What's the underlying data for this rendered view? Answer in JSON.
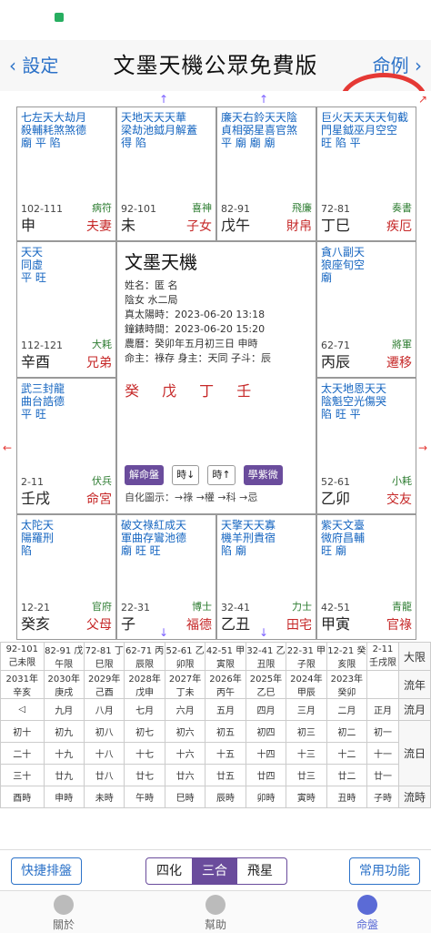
{
  "nav": {
    "back_label": "設定",
    "title": "文墨天機公眾免費版",
    "next_label": "命例"
  },
  "cells": [
    {
      "name": "top-left",
      "stars": "七左天大劫月\n殺輔耗煞煞德\n廟 平 陷",
      "branch": "申",
      "palace": "夫妻",
      "range": "102-111",
      "minor": "病符"
    },
    {
      "name": "top-mid-left",
      "stars": "天地天天天華\n梁劫池鉞月解蓋\n得 陷",
      "branch": "未",
      "palace": "子女",
      "range": "92-101",
      "minor": "喜神"
    },
    {
      "name": "top-mid-right",
      "stars": "廉天右鈴天天陰\n貞相弼星喜官煞\n平 廟 廟 廟",
      "branch": "戊午",
      "palace": "財帛",
      "range": "82-91",
      "minor": "飛廉"
    },
    {
      "name": "top-right",
      "stars": "巨火天天天天旬截\n門星鉞巫月空空\n旺 陷 平",
      "branch": "丁巳",
      "palace": "疾厄",
      "range": "72-81",
      "minor": "奏書"
    },
    {
      "name": "mid-left-top",
      "stars": "天天\n同虛\n平 旺",
      "branch": "辛酉",
      "palace": "兄弟",
      "range": "112-121",
      "minor": "大耗"
    },
    {
      "name": "mid-right-top",
      "stars": "貪八副天\n狼座旬空\n廟",
      "branch": "丙辰",
      "palace": "遷移",
      "range": "62-71",
      "minor": "將軍"
    },
    {
      "name": "mid-left-bot",
      "stars": "武三封龍\n曲台誥德\n平 旺",
      "branch": "壬戌",
      "palace": "命宮",
      "range": "2-11",
      "minor": "伏兵"
    },
    {
      "name": "mid-right-bot",
      "stars": "太天地恩天天\n陰魁空光傷哭\n陷 旺 平",
      "branch": "乙卯",
      "palace": "交友",
      "range": "52-61",
      "minor": "小耗"
    },
    {
      "name": "bot-left",
      "stars": "太陀天\n陽羅刑\n陷",
      "branch": "癸亥",
      "palace": "父母",
      "range": "12-21",
      "minor": "官府"
    },
    {
      "name": "bot-mid-left",
      "stars": "破文祿紅成天\n軍曲存鸞池德\n廟 旺 旺",
      "branch": "子",
      "palace": "福德",
      "range": "22-31",
      "minor": "博士"
    },
    {
      "name": "bot-mid-right",
      "stars": "天擎天天寡\n機羊刑貴宿\n陷 廟",
      "branch": "乙丑",
      "palace": "田宅",
      "range": "32-41",
      "minor": "力士"
    },
    {
      "name": "bot-right",
      "stars": "紫天文臺\n微府昌輔\n旺 廟",
      "branch": "甲寅",
      "palace": "官祿",
      "range": "42-51",
      "minor": "青龍"
    }
  ],
  "center": {
    "title": "文墨天機",
    "info": [
      "姓名：匿 名",
      "陰女 水二局",
      "真太陽時：2023-06-20 13:18",
      "鐘錶時間：2023-06-20 15:20",
      "農曆：癸卯年五月初三日 申時",
      "命主：祿存 身主：天同 子斗：辰"
    ],
    "gan": "癸 戊 丁 壬",
    "btn_jieming": "解命盤",
    "btn_shi_prev": "時↓",
    "btn_shi_next": "時↑",
    "btn_xue": "學紫微",
    "legend": "自化圖示：→祿 →權 →科 →忌"
  },
  "grid": {
    "row_dayun": [
      "92-101 己未限",
      "82-91 戊午限",
      "72-81 丁巳限",
      "62-71 丙辰限",
      "52-61 乙卯限",
      "42-51 甲寅限",
      "32-41 乙丑限",
      "22-31 甲子限",
      "12-21 癸亥限",
      "2-11 壬戌限"
    ],
    "row_liunian": [
      "2031年 辛亥",
      "2030年 庚戌",
      "2029年 己酉",
      "2028年 戊申",
      "2027年 丁未",
      "2026年 丙午",
      "2025年 乙巳",
      "2024年 甲辰",
      "2023年 癸卯"
    ],
    "row_month": [
      "正月",
      "二月",
      "三月",
      "四月",
      "五月",
      "六月",
      "七月",
      "八月",
      "九月"
    ],
    "day1": [
      "初一",
      "初二",
      "初三",
      "初四",
      "初五",
      "初六",
      "初七",
      "初八",
      "初九",
      "初十"
    ],
    "day2": [
      "十一",
      "十二",
      "十三",
      "十四",
      "十五",
      "十六",
      "十七",
      "十八",
      "十九",
      "二十"
    ],
    "day3": [
      "廿一",
      "廿二",
      "廿三",
      "廿四",
      "廿五",
      "廿六",
      "廿七",
      "廿八",
      "廿九",
      "三十"
    ],
    "hours": [
      "子時",
      "丑時",
      "寅時",
      "卯時",
      "辰時",
      "巳時",
      "午時",
      "未時",
      "申時",
      "酉時"
    ],
    "side_labels": [
      "大限",
      "流年",
      "流月",
      "流日",
      "流時"
    ]
  },
  "bottombar": {
    "left": "快捷排盤",
    "seg": [
      "四化",
      "三合",
      "飛星"
    ],
    "right": "常用功能"
  },
  "tabs": [
    "命盤",
    "幫助",
    "關於"
  ]
}
